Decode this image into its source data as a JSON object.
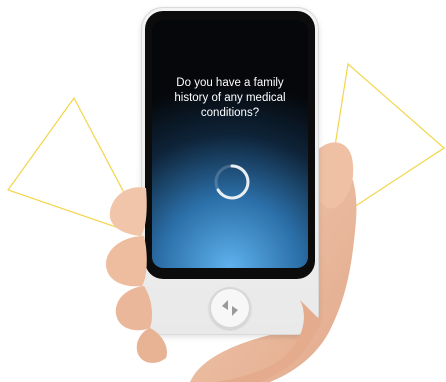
{
  "screen": {
    "question": "Do you have a family history of any medical conditions?",
    "status_icon": "loading-spinner-icon"
  },
  "device": {
    "home_button_icon": "translate-arrows-icon"
  },
  "colors": {
    "accent_lines": "#f2d54a",
    "screen_glow": "#5fb2ee",
    "device_body": "#f0f0f0"
  }
}
